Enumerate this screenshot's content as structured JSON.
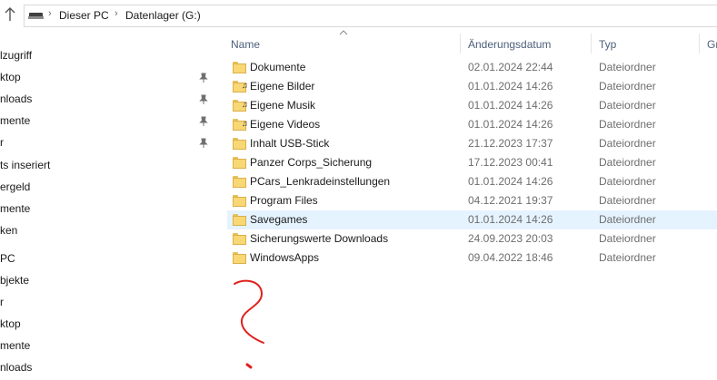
{
  "address": {
    "breadcrumb": [
      "Dieser PC",
      "Datenlager (G:)"
    ]
  },
  "nav": {
    "items": [
      {
        "label": "lzugriff",
        "pinned": false
      },
      {
        "label": "ktop",
        "pinned": true
      },
      {
        "label": "nloads",
        "pinned": true
      },
      {
        "label": "mente",
        "pinned": true
      },
      {
        "label": "r",
        "pinned": true
      },
      {
        "label": "ts inseriert",
        "pinned": false
      },
      {
        "label": "ergeld",
        "pinned": false
      },
      {
        "label": "mente",
        "pinned": false
      },
      {
        "label": "ken",
        "pinned": false
      },
      {
        "label": "PC",
        "pinned": false
      },
      {
        "label": "bjekte",
        "pinned": false
      },
      {
        "label": "r",
        "pinned": false
      },
      {
        "label": "ktop",
        "pinned": false
      },
      {
        "label": "mente",
        "pinned": false
      },
      {
        "label": "nloads",
        "pinned": false
      }
    ]
  },
  "columns": {
    "name": "Name",
    "date": "Änderungsdatum",
    "type": "Typ",
    "size": "Gr"
  },
  "files": [
    {
      "name": "Dokumente",
      "date": "02.01.2024 22:44",
      "type": "Dateiordner",
      "special": false
    },
    {
      "name": "Eigene Bilder",
      "date": "01.01.2024 14:26",
      "type": "Dateiordner",
      "special": true
    },
    {
      "name": "Eigene Musik",
      "date": "01.01.2024 14:26",
      "type": "Dateiordner",
      "special": true
    },
    {
      "name": "Eigene Videos",
      "date": "01.01.2024 14:26",
      "type": "Dateiordner",
      "special": true
    },
    {
      "name": "Inhalt USB-Stick",
      "date": "21.12.2023 17:37",
      "type": "Dateiordner",
      "special": false
    },
    {
      "name": "Panzer Corps_Sicherung",
      "date": "17.12.2023 00:41",
      "type": "Dateiordner",
      "special": false
    },
    {
      "name": "PCars_Lenkradeinstellungen",
      "date": "01.01.2024 14:26",
      "type": "Dateiordner",
      "special": false
    },
    {
      "name": "Program Files",
      "date": "04.12.2021 19:37",
      "type": "Dateiordner",
      "special": false
    },
    {
      "name": "Savegames",
      "date": "01.01.2024 14:26",
      "type": "Dateiordner",
      "special": false,
      "selected": true
    },
    {
      "name": "Sicherungswerte Downloads",
      "date": "24.09.2023 20:03",
      "type": "Dateiordner",
      "special": false
    },
    {
      "name": "WindowsApps",
      "date": "09.04.2022 18:46",
      "type": "Dateiordner",
      "special": false
    }
  ],
  "colors": {
    "selection": "#e5f3ff",
    "folder": "#f8d775",
    "header_text": "#4c607a",
    "scribble": "#e0201c"
  }
}
